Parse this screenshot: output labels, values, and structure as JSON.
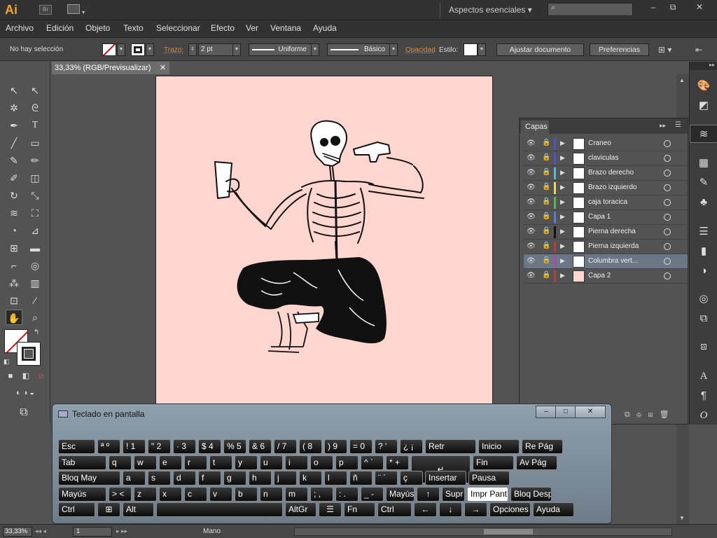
{
  "titlebar": {
    "logo": "Ai",
    "br": "Br",
    "workspace": "Aspectos esenciales ▾",
    "minimize": "–",
    "restore": "⧉",
    "close": "✕"
  },
  "menu": [
    "Archivo",
    "Edición",
    "Objeto",
    "Texto",
    "Seleccionar",
    "Efecto",
    "Ver",
    "Ventana",
    "Ayuda"
  ],
  "control": {
    "selection": "No hay selección",
    "trazo_label": "Trazo:",
    "trazo_value": "2 pt",
    "uniform": "Uniforme",
    "basico": "Básico",
    "opacidad": "Opacidad",
    "estilo": "Estilo:",
    "adjust_btn": "Ajustar documento",
    "prefs_btn": "Preferencias"
  },
  "document": {
    "tab": "33,33% (RGB/Previsualizar)",
    "close": "✕"
  },
  "layers": {
    "title": "Capas",
    "items": [
      {
        "name": "Craneo",
        "color": "#4a4aff"
      },
      {
        "name": "claviculas",
        "color": "#4a4aff"
      },
      {
        "name": "Brazo derecho",
        "color": "#22d3ee"
      },
      {
        "name": "Brazo izquierdo",
        "color": "#f5e026"
      },
      {
        "name": "caja toracica",
        "color": "#33cc33"
      },
      {
        "name": "Capa 1",
        "color": "#4a7aff"
      },
      {
        "name": "Pierna derecha",
        "color": "#111111"
      },
      {
        "name": "Pierna izquierda",
        "color": "#cc3333"
      },
      {
        "name": "Columbra vert...",
        "color": "#cc33cc",
        "selected": true
      },
      {
        "name": "Capa 2",
        "color": "#cc3333"
      }
    ]
  },
  "status": {
    "zoom": "33,33%",
    "page": "1",
    "tool": "Mano"
  },
  "keyboard": {
    "title": "Teclado en pantalla",
    "rows": [
      [
        "Esc",
        "ª º",
        "! 1",
        "\" 2",
        "· 3",
        "$ 4",
        "% 5",
        "& 6",
        "/ 7",
        "( 8",
        ") 9",
        "= 0",
        "? '",
        "¿ ¡",
        "Retr",
        "Inicio",
        "Re Pág"
      ],
      [
        "Tab",
        "q",
        "w",
        "e",
        "r",
        "t",
        "y",
        "u",
        "i",
        "o",
        "p",
        "^ `",
        "* +",
        "↵",
        "Fin",
        "Av Pág"
      ],
      [
        "Bloq May",
        "a",
        "s",
        "d",
        "f",
        "g",
        "h",
        "j",
        "k",
        "l",
        "ñ",
        "¨ ´",
        "ç",
        "Insertar",
        "Pausa"
      ],
      [
        "Mayús",
        "> <",
        "z",
        "x",
        "c",
        "v",
        "b",
        "n",
        "m",
        "; ,",
        ": .",
        "_ -",
        "Mayús",
        "↑",
        "Supr",
        "Impr Pant",
        "Bloq Despl"
      ],
      [
        "Ctrl",
        "⊞",
        "Alt",
        "",
        "AltGr",
        "☰",
        "Fn",
        "Ctrl",
        "←",
        "↓",
        "→",
        "Opciones",
        "Ayuda"
      ]
    ]
  }
}
